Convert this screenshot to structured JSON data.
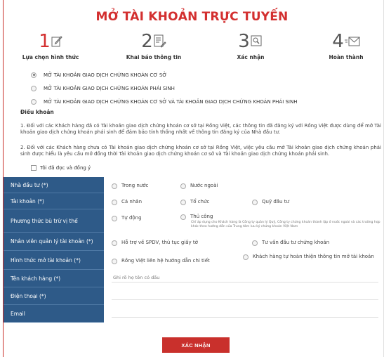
{
  "title": "MỞ TÀI KHOẢN TRỰC TUYẾN",
  "steps": [
    {
      "num": "1",
      "label": "Lựa chọn hình thức"
    },
    {
      "num": "2",
      "label": "Khai báo thông tin"
    },
    {
      "num": "3",
      "label": "Xác nhận"
    },
    {
      "num": "4",
      "label": "Hoàn thành"
    }
  ],
  "account_options": [
    "MỞ TÀI KHOẢN GIAO DỊCH CHỨNG KHOÁN CƠ SỞ",
    "MỞ TÀI KHOẢN GIAO DỊCH CHỨNG KHOÁN PHÁI SINH",
    "MỞ TÀI KHOẢN GIAO DỊCH CHỨNG KHOÁN CƠ SỞ VÀ TÀI KHOẢN GIAO DỊCH CHỨNG KHOÁN PHÁI SINH"
  ],
  "terms": {
    "heading": "Điều khoản",
    "p1": "1.  Đối với các Khách hàng đã có Tài khoản giao dịch chứng khoán cơ sở tại Rồng Việt, các thông tin đã đăng ký với Rồng Việt được dùng để mở Tài khoản giao dịch chứng khoán phái sinh để đảm bảo tính thống nhất về thông tin đăng ký của Nhà đầu tư.",
    "p2": "2.  Đối với các Khách hàng chưa có Tài khoản giao dịch chứng khoán cơ sở tại Rồng Việt, việc yêu cầu mở Tài khoản giao dịch chứng khoán phái sinh được hiểu là yêu cầu mở đồng thời Tài khoản giao dịch chứng khoán cơ sở và Tài khoản giao dịch chứng khoán phái sinh.",
    "agree": "Tôi đã đọc và đồng ý"
  },
  "form": {
    "investor_label": "Nhà đầu tư (*)",
    "investor_opt1": "Trong nước",
    "investor_opt2": "Nước ngoài",
    "account_label": "Tài khoản (*)",
    "account_opt1": "Cá nhân",
    "account_opt2": "Tổ chức",
    "account_opt3": "Quỹ đầu tư",
    "position_label": "Phương thức bù trừ vị thế",
    "position_opt1": "Tự động",
    "position_opt2": "Thủ công",
    "position_note": "Chỉ áp dụng cho Khách hàng là Công ty quản lý Quỹ, Công ty chứng khoán thành lập ở nước ngoài và các trường hợp khác theo hướng dẫn của Trung tâm lưu ký chứng khoán Việt Nam",
    "staff_label": "Nhân viên quản lý tài khoản (*)",
    "staff_opt1": "Hỗ trợ về SPDV, thủ tục giấy tờ",
    "staff_opt2": "Tư vấn đầu tư chứng khoán",
    "method_label": "Hình thức mở tài khoản (*)",
    "method_opt1": "Rồng Việt liên hệ hướng dẫn chi tiết",
    "method_opt2": "Khách hàng tự hoàn thiện thông tin mở tài khoản",
    "name_label": "Tên khách hàng (*)",
    "name_placeholder": "Ghi rõ họ tên có dấu",
    "phone_label": "Điện thoại (*)",
    "email_label": "Email"
  },
  "submit_label": "XÁC NHẬN",
  "colors": {
    "accent": "#d32f2f",
    "label_bg": "#2e5a88"
  }
}
